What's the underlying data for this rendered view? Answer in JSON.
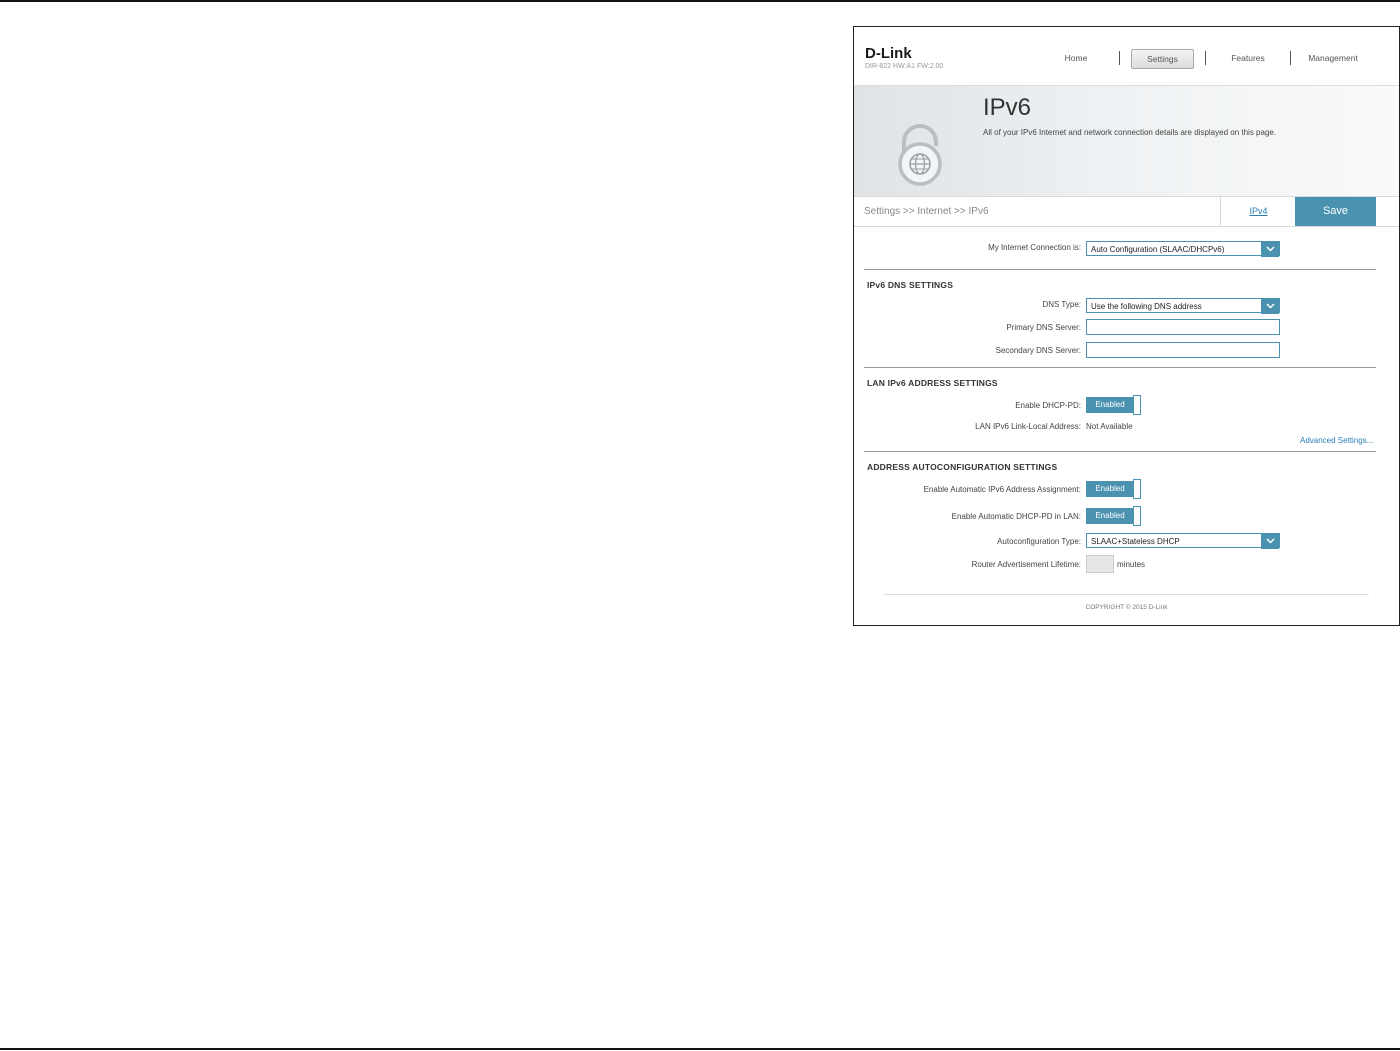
{
  "header": {
    "logo": "D-Link",
    "model": "DIR-822 HW:A1 FW:2.00",
    "nav": [
      {
        "label": "Home",
        "active": false
      },
      {
        "label": "Settings",
        "active": true
      },
      {
        "label": "Features",
        "active": false
      },
      {
        "label": "Management",
        "active": false
      }
    ]
  },
  "banner": {
    "title": "IPv6",
    "description": "All of your IPv6 Internet and network connection details are displayed on this page.",
    "icon": "unlocked-padlock-globe-icon"
  },
  "breadcrumb": {
    "path": "Settings >> Internet >> IPv6",
    "ipv4_link": "IPv4",
    "save_label": "Save"
  },
  "connection": {
    "label": "My Internet Connection is:",
    "value": "Auto Configuration (SLAAC/DHCPv6)"
  },
  "dns": {
    "title": "IPv6 DNS SETTINGS",
    "type_label": "DNS Type:",
    "type_value": "Use the following DNS address",
    "primary_label": "Primary DNS Server:",
    "primary_value": "",
    "secondary_label": "Secondary DNS Server:",
    "secondary_value": ""
  },
  "lan": {
    "title": "LAN IPv6 ADDRESS SETTINGS",
    "dhcp_pd_label": "Enable DHCP-PD:",
    "dhcp_pd_value": "Enabled",
    "link_local_label": "LAN IPv6 Link-Local Address:",
    "link_local_value": "Not Available",
    "advanced_link": "Advanced Settings..."
  },
  "autoconf": {
    "title": "ADDRESS AUTOCONFIGURATION SETTINGS",
    "auto_assign_label": "Enable Automatic IPv6 Address Assignment:",
    "auto_assign_value": "Enabled",
    "auto_dhcp_pd_label": "Enable Automatic DHCP-PD in LAN:",
    "auto_dhcp_pd_value": "Enabled",
    "type_label": "Autoconfiguration Type:",
    "type_value": "SLAAC+Stateless DHCP",
    "lifetime_label": "Router Advertisement Lifetime:",
    "lifetime_value": "",
    "lifetime_unit": "minutes"
  },
  "footer": {
    "copyright": "COPYRIGHT © 2015 D-Link"
  },
  "colors": {
    "accent": "#4a92b0",
    "link": "#2a7fb5"
  }
}
